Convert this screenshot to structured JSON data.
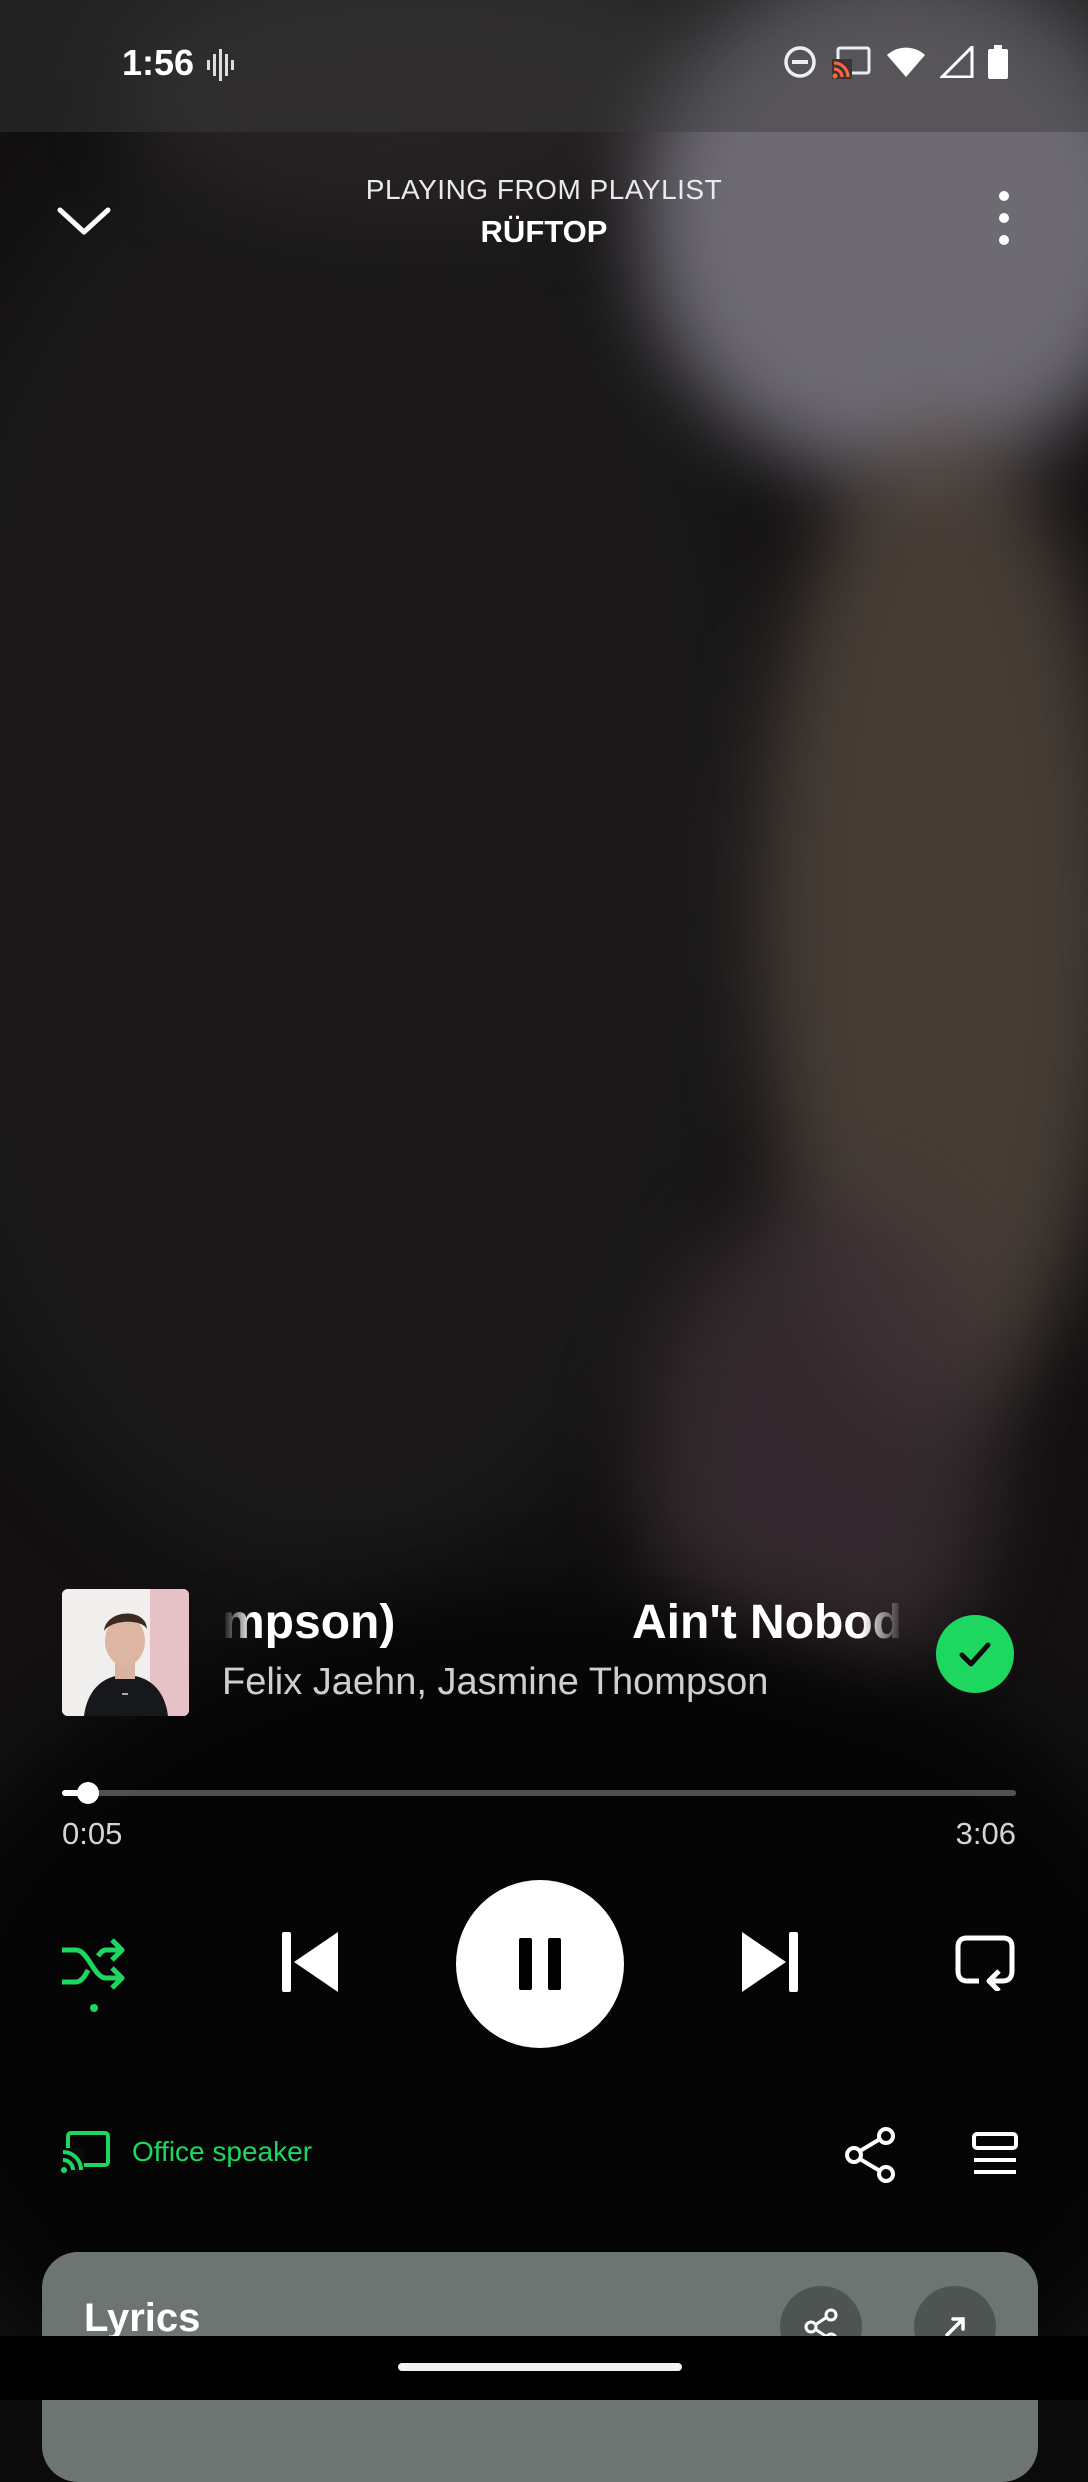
{
  "status_bar": {
    "time": "1:56",
    "icons": [
      "vibrate-icon",
      "do-not-disturb-icon",
      "cast-icon",
      "wifi-icon",
      "signal-icon",
      "battery-icon"
    ]
  },
  "header": {
    "context_label": "PLAYING FROM PLAYLIST",
    "playlist_name": "RÜFTOP"
  },
  "track": {
    "title_tail": "mpson)",
    "title_head": "Ain't Nobod",
    "artists": "Felix Jaehn, Jasmine Thompson",
    "liked": true
  },
  "playback": {
    "elapsed": "0:05",
    "duration": "3:06",
    "progress_fraction": 0.027,
    "shuffle_on": true,
    "state": "playing"
  },
  "device": {
    "name": "Office speaker"
  },
  "lyrics_card": {
    "title": "Lyrics"
  },
  "colors": {
    "accent": "#1ed760",
    "card": "#6d7572"
  }
}
